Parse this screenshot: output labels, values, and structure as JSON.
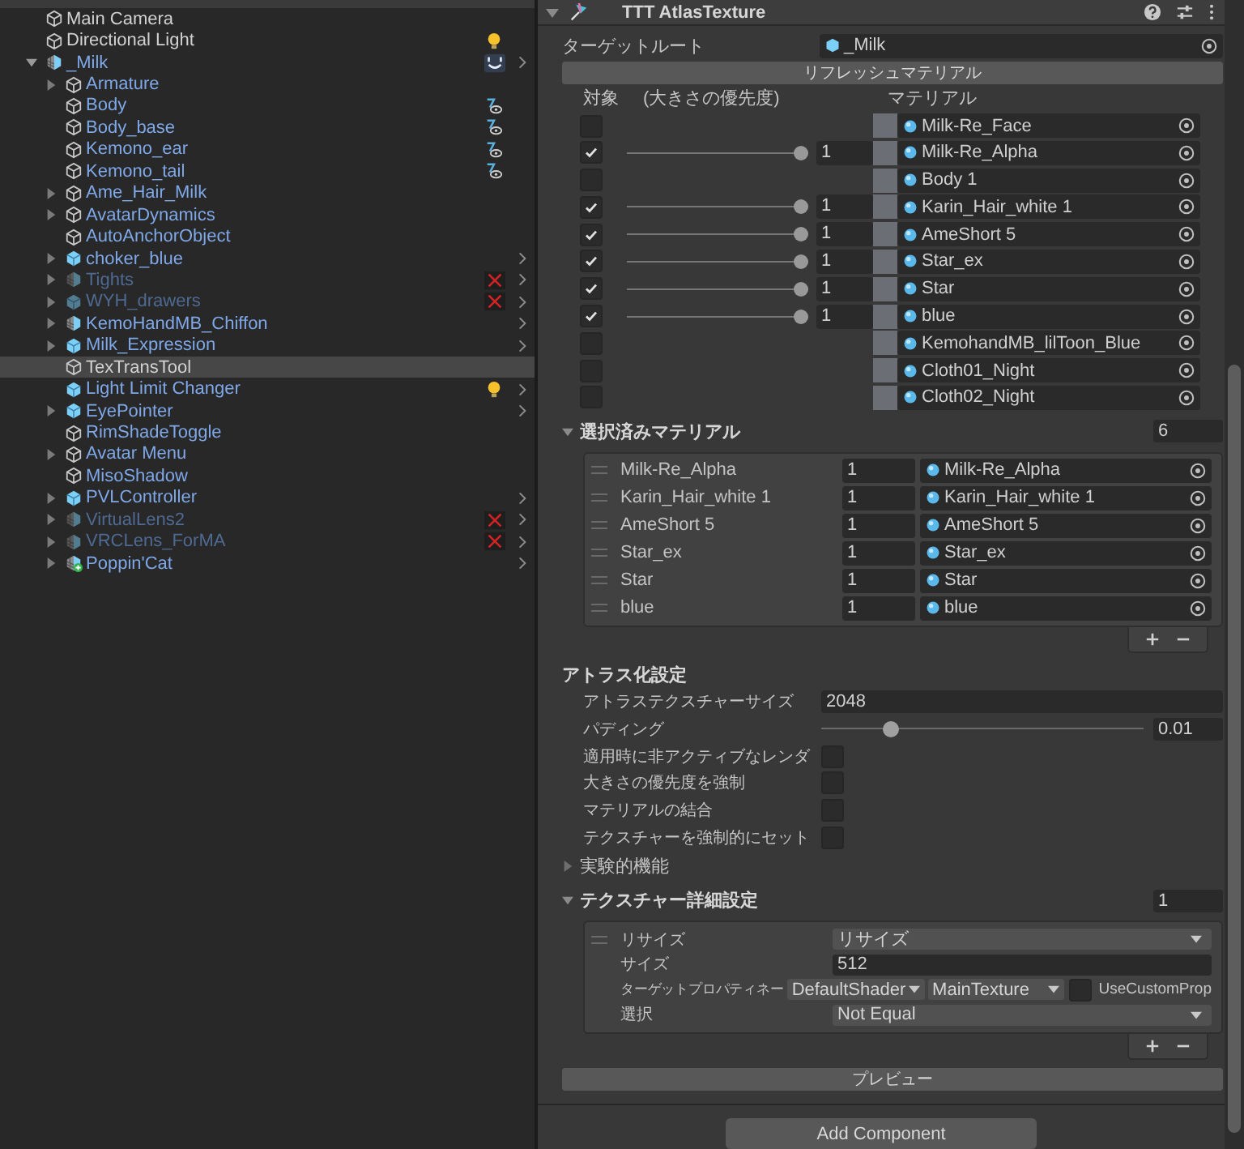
{
  "hierarchy": {
    "items": [
      {
        "name": "Main Camera",
        "kind": "object",
        "prefab": false,
        "disabled": false,
        "selected": false,
        "chevron": false
      },
      {
        "name": "Directional Light",
        "kind": "object",
        "prefab": false,
        "disabled": false,
        "selected": false,
        "chevron": false,
        "badges": [
          {
            "kind": "light"
          }
        ]
      },
      {
        "name": "_Milk",
        "kind": "model",
        "prefab": true,
        "disabled": false,
        "selected": false,
        "expanded": true,
        "chevron": true,
        "badges": [
          {
            "kind": "avatar"
          }
        ],
        "children": [
          {
            "name": "Armature",
            "kind": "object",
            "prefab": true,
            "disabled": false,
            "selected": false,
            "expanded": false,
            "chevron": false
          },
          {
            "name": "Body",
            "kind": "object",
            "prefab": true,
            "disabled": false,
            "selected": false,
            "chevron": false,
            "badges": [
              {
                "kind": "visibility"
              }
            ]
          },
          {
            "name": "Body_base",
            "kind": "object",
            "prefab": true,
            "disabled": false,
            "selected": false,
            "chevron": false,
            "badges": [
              {
                "kind": "visibility"
              }
            ]
          },
          {
            "name": "Kemono_ear",
            "kind": "object",
            "prefab": true,
            "disabled": false,
            "selected": false,
            "chevron": false,
            "badges": [
              {
                "kind": "visibility"
              }
            ]
          },
          {
            "name": "Kemono_tail",
            "kind": "object",
            "prefab": true,
            "disabled": false,
            "selected": false,
            "chevron": false,
            "badges": [
              {
                "kind": "visibility"
              }
            ]
          },
          {
            "name": "Ame_Hair_Milk",
            "kind": "object",
            "prefab": true,
            "disabled": false,
            "selected": false,
            "expanded": false,
            "chevron": false
          },
          {
            "name": "AvatarDynamics",
            "kind": "object",
            "prefab": true,
            "disabled": false,
            "selected": false,
            "expanded": false,
            "chevron": false
          },
          {
            "name": "AutoAnchorObject",
            "kind": "object",
            "prefab": true,
            "disabled": false,
            "selected": false,
            "chevron": false
          },
          {
            "name": "choker_blue",
            "kind": "prefab",
            "prefab": true,
            "disabled": false,
            "selected": false,
            "expanded": false,
            "chevron": true
          },
          {
            "name": "Tights",
            "kind": "model",
            "prefab": true,
            "disabled": true,
            "selected": false,
            "expanded": false,
            "chevron": true,
            "badges": [
              {
                "kind": "error"
              }
            ]
          },
          {
            "name": "WYH_drawers",
            "kind": "prefab",
            "prefab": true,
            "disabled": true,
            "selected": false,
            "expanded": false,
            "chevron": true,
            "badges": [
              {
                "kind": "error"
              }
            ]
          },
          {
            "name": "KemoHandMB_Chiffon",
            "kind": "model",
            "prefab": true,
            "disabled": false,
            "selected": false,
            "expanded": false,
            "chevron": true
          },
          {
            "name": "Milk_Expression",
            "kind": "prefab",
            "prefab": true,
            "disabled": false,
            "selected": false,
            "expanded": false,
            "chevron": true
          },
          {
            "name": "TexTransTool",
            "kind": "object",
            "prefab": false,
            "disabled": false,
            "selected": true,
            "chevron": false
          },
          {
            "name": "Light Limit Changer",
            "kind": "prefab",
            "prefab": true,
            "disabled": false,
            "selected": false,
            "chevron": true,
            "badges": [
              {
                "kind": "light"
              }
            ]
          },
          {
            "name": "EyePointer",
            "kind": "prefab",
            "prefab": true,
            "disabled": false,
            "selected": false,
            "expanded": false,
            "chevron": true
          },
          {
            "name": "RimShadeToggle",
            "kind": "object",
            "prefab": true,
            "disabled": false,
            "selected": false,
            "chevron": false
          },
          {
            "name": "Avatar Menu",
            "kind": "object",
            "prefab": true,
            "disabled": false,
            "selected": false,
            "expanded": false,
            "chevron": false
          },
          {
            "name": "MisoShadow",
            "kind": "object",
            "prefab": true,
            "disabled": false,
            "selected": false,
            "chevron": false
          },
          {
            "name": "PVLController",
            "kind": "prefab",
            "prefab": true,
            "disabled": false,
            "selected": false,
            "expanded": false,
            "chevron": true
          },
          {
            "name": "VirtualLens2",
            "kind": "model",
            "prefab": true,
            "disabled": true,
            "selected": false,
            "expanded": false,
            "chevron": true,
            "badges": [
              {
                "kind": "error"
              }
            ]
          },
          {
            "name": "VRCLens_ForMA",
            "kind": "model",
            "prefab": true,
            "disabled": true,
            "selected": false,
            "expanded": false,
            "chevron": true,
            "badges": [
              {
                "kind": "error"
              }
            ]
          },
          {
            "name": "Poppin'Cat",
            "kind": "model_added",
            "prefab": true,
            "disabled": false,
            "selected": false,
            "expanded": false,
            "chevron": true
          }
        ]
      }
    ]
  },
  "component": {
    "title": "TTT AtlasTexture",
    "expanded": true,
    "target_root": {
      "label": "ターゲットルート",
      "value": "_Milk"
    },
    "refresh_button": "リフレッシュマテリアル",
    "material_columns": [
      "対象",
      "(大きさの優先度)",
      "マテリアル"
    ],
    "materials": [
      {
        "checked": false,
        "name": "Milk-Re_Face"
      },
      {
        "checked": true,
        "level": 1,
        "value": "1",
        "name": "Milk-Re_Alpha"
      },
      {
        "checked": false,
        "name": "Body 1"
      },
      {
        "checked": true,
        "level": 1,
        "value": "1",
        "name": "Karin_Hair_white 1"
      },
      {
        "checked": true,
        "level": 1,
        "value": "1",
        "name": "AmeShort 5"
      },
      {
        "checked": true,
        "level": 1,
        "value": "1",
        "name": "Star_ex"
      },
      {
        "checked": true,
        "level": 1,
        "value": "1",
        "name": "Star"
      },
      {
        "checked": true,
        "level": 1,
        "value": "1",
        "name": "blue"
      },
      {
        "checked": false,
        "name": "KemohandMB_lilToon_Blue"
      },
      {
        "checked": false,
        "name": "Cloth01_Night"
      },
      {
        "checked": false,
        "name": "Cloth02_Night"
      }
    ],
    "selected_materials": {
      "title": "選択済みマテリアル",
      "expanded": true,
      "count": "6",
      "rows": [
        {
          "name": "Milk-Re_Alpha",
          "value": "1",
          "material": "Milk-Re_Alpha"
        },
        {
          "name": "Karin_Hair_white 1",
          "value": "1",
          "material": "Karin_Hair_white 1"
        },
        {
          "name": "AmeShort 5",
          "value": "1",
          "material": "AmeShort 5"
        },
        {
          "name": "Star_ex",
          "value": "1",
          "material": "Star_ex"
        },
        {
          "name": "Star",
          "value": "1",
          "material": "Star"
        },
        {
          "name": "blue",
          "value": "1",
          "material": "blue"
        }
      ]
    },
    "atlas_settings": {
      "title": "アトラス化設定",
      "texture_size": {
        "label": "アトラステクスチャーサイズ",
        "value": "2048"
      },
      "padding": {
        "label": "パディング",
        "level": 0.2,
        "value": "0.01"
      },
      "toggles": [
        {
          "label": "適用時に非アクティブなレンダ",
          "checked": false
        },
        {
          "label": "大きさの優先度を強制",
          "checked": false
        },
        {
          "label": "マテリアルの結合",
          "checked": false
        },
        {
          "label": "テクスチャーを強制的にセット",
          "checked": false
        }
      ]
    },
    "experimental": {
      "title": "実験的機能",
      "expanded": false
    },
    "texture_detail": {
      "title": "テクスチャー詳細設定",
      "expanded": true,
      "count": "1",
      "resize": {
        "label": "リサイズ",
        "value": "リサイズ"
      },
      "size": {
        "label": "サイズ",
        "value": "512"
      },
      "target_property": {
        "label": "ターゲットプロパティネー",
        "shader": "DefaultShader",
        "property": "MainTexture",
        "custom_label": "UseCustomProp",
        "custom_checked": false
      },
      "select": {
        "label": "選択",
        "value": "Not Equal"
      }
    },
    "preview_button": "プレビュー"
  },
  "add_component_button": "Add Component"
}
